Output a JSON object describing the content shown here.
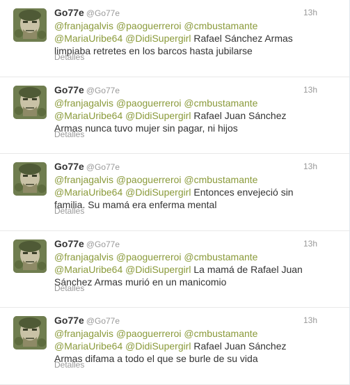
{
  "tweets": [
    {
      "fullname": "Go77e",
      "username": "@Go77e",
      "time": "13h",
      "mentions": [
        "@franjagalvis",
        "@paoguerreroi",
        "@cmbustamante",
        "@MariaUribe64",
        "@DidiSupergirl"
      ],
      "text": "Rafael Sánchez Armas limpiaba retretes en los barcos hasta jubilarse",
      "details_label": "Detalles"
    },
    {
      "fullname": "Go77e",
      "username": "@Go77e",
      "time": "13h",
      "mentions": [
        "@franjagalvis",
        "@paoguerreroi",
        "@cmbustamante",
        "@MariaUribe64",
        "@DidiSupergirl"
      ],
      "text": "Rafael Juan Sánchez Armas nunca tuvo mujer sin pagar, ni hijos",
      "details_label": "Detalles"
    },
    {
      "fullname": "Go77e",
      "username": "@Go77e",
      "time": "13h",
      "mentions": [
        "@franjagalvis",
        "@paoguerreroi",
        "@cmbustamante",
        "@MariaUribe64",
        "@DidiSupergirl"
      ],
      "text": "Entonces envejeció sin familia. Su mamá era enferma mental",
      "details_label": "Detalles"
    },
    {
      "fullname": "Go77e",
      "username": "@Go77e",
      "time": "13h",
      "mentions": [
        "@franjagalvis",
        "@paoguerreroi",
        "@cmbustamante",
        "@MariaUribe64",
        "@DidiSupergirl"
      ],
      "text": "La mamá de Rafael Juan Sánchez Armas murió en un manicomio",
      "details_label": "Detalles"
    },
    {
      "fullname": "Go77e",
      "username": "@Go77e",
      "time": "13h",
      "mentions": [
        "@franjagalvis",
        "@paoguerreroi",
        "@cmbustamante",
        "@MariaUribe64",
        "@DidiSupergirl"
      ],
      "text": "Rafael Juan Sánchez Armas difama a todo el que se burle de su vida",
      "details_label": "Detalles"
    }
  ],
  "colors": {
    "mention": "#8a9a3a",
    "meta": "#999999",
    "text": "#333333",
    "divider": "#e8e8e8"
  },
  "icons": {
    "avatar": "user-avatar-image"
  }
}
